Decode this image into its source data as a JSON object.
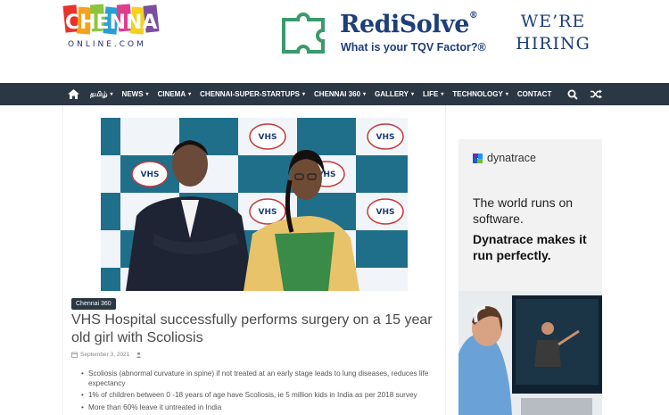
{
  "header": {
    "logo_text": "CHENNAI",
    "logo_sub": "ONLINE.COM",
    "ad": {
      "brand": "RediSolve",
      "tagline": "What is your TQV Factor?®",
      "hiring_line1": "WE’RE",
      "hiring_line2": "HIRING"
    }
  },
  "nav": {
    "items": [
      {
        "label": "தமிழ்",
        "caret": "▾"
      },
      {
        "label": "NEWS",
        "caret": "▾"
      },
      {
        "label": "CINEMA",
        "caret": "▾"
      },
      {
        "label": "CHENNAI-SUPER-STARTUPS",
        "caret": "▾"
      },
      {
        "label": "CHENNAI 360",
        "caret": "▾"
      },
      {
        "label": "GALLERY",
        "caret": "▾"
      },
      {
        "label": "LIFE",
        "caret": "▾"
      },
      {
        "label": "TECHNOLOGY",
        "caret": "▾"
      },
      {
        "label": "CONTACT",
        "caret": ""
      }
    ]
  },
  "article": {
    "category": "Chennai 360",
    "title": "VHS Hospital successfully performs surgery on a 15 year old girl with Scoliosis",
    "date": "September 3, 2021",
    "bullets": [
      "Scoliosis (abnormal curvature in spine) if not treated at an early stage leads to lung diseases, reduces life expectancy",
      "1% of children between 0 -18 years of age have Scoliosis, ie 5 million kids in India as per 2018 survey",
      "More than 60% leave it untreated in India"
    ],
    "backdrop_text": "VHS"
  },
  "side_ad": {
    "brand": "dynatrace",
    "line1": "The world runs on software.",
    "line2": "Dynatrace makes it run perfectly."
  },
  "colors": {
    "nav_bg": "#2c3744",
    "brand_blue": "#1d3e7a",
    "puzzle_green": "#3a9a6a"
  }
}
